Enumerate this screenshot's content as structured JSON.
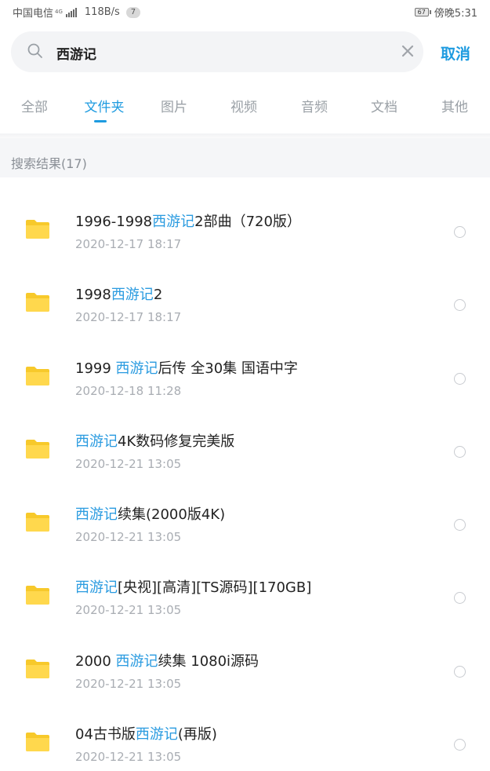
{
  "status_bar": {
    "carrier": "中国电信",
    "network": "4G",
    "speed": "118B/s",
    "notification_count": "7",
    "battery": "67",
    "time": "傍晚5:31"
  },
  "search": {
    "query": "西游记",
    "cancel_label": "取消"
  },
  "tabs": [
    {
      "label": "全部",
      "active": false
    },
    {
      "label": "文件夹",
      "active": true
    },
    {
      "label": "图片",
      "active": false
    },
    {
      "label": "视频",
      "active": false
    },
    {
      "label": "音频",
      "active": false
    },
    {
      "label": "文档",
      "active": false
    },
    {
      "label": "其他",
      "active": false
    }
  ],
  "results": {
    "title": "搜索结果(17)",
    "items": [
      {
        "parts": [
          "1996-1998",
          "西游记",
          "2部曲（720版）"
        ],
        "date": "2020-12-17  18:17"
      },
      {
        "parts": [
          "1998",
          "西游记",
          "2"
        ],
        "date": "2020-12-17  18:17"
      },
      {
        "parts": [
          "1999 ",
          "西游记",
          "后传 全30集 国语中字"
        ],
        "date": "2020-12-18  11:28"
      },
      {
        "parts": [
          "",
          "西游记",
          "4K数码修复完美版"
        ],
        "date": "2020-12-21  13:05"
      },
      {
        "parts": [
          "",
          "西游记",
          "续集(2000版4K)"
        ],
        "date": "2020-12-21  13:05"
      },
      {
        "parts": [
          "",
          "西游记",
          "[央视][高清][TS源码][170GB]"
        ],
        "date": "2020-12-21  13:05"
      },
      {
        "parts": [
          "2000 ",
          "西游记",
          "续集 1080i源码"
        ],
        "date": "2020-12-21  13:05"
      },
      {
        "parts": [
          "04古书版",
          "西游记",
          "(再版)"
        ],
        "date": "2020-12-21  13:05"
      }
    ]
  },
  "colors": {
    "accent": "#1e9be0",
    "highlight": "#2a9be0",
    "folder": "#ffd84d"
  },
  "icons": {
    "search": "search-icon",
    "clear": "close-icon",
    "folder": "folder-icon",
    "select": "radio-circle-icon"
  }
}
